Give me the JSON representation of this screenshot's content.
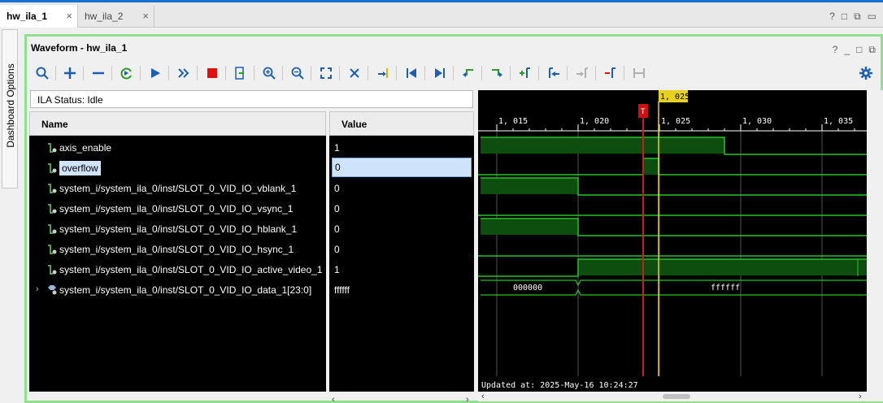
{
  "tabs": [
    {
      "label": "hw_ila_1",
      "close": "×"
    },
    {
      "label": "hw_ila_2",
      "close": "×"
    }
  ],
  "top_icons": [
    "?",
    "□",
    "⧉",
    "▭"
  ],
  "sidebar": {
    "label": "Dashboard Options"
  },
  "panel": {
    "title": "Waveform - hw_ila_1",
    "icons": [
      "?",
      "_",
      "□",
      "⧉"
    ]
  },
  "ila_status": "ILA Status:  Idle",
  "columns": {
    "name": "Name",
    "value": "Value"
  },
  "signals": [
    {
      "name": "axis_enable",
      "value": "1"
    },
    {
      "name": "overflow",
      "value": "0"
    },
    {
      "name": "system_i/system_ila_0/inst/SLOT_0_VID_IO_vblank_1",
      "value": "0"
    },
    {
      "name": "system_i/system_ila_0/inst/SLOT_0_VID_IO_vsync_1",
      "value": "0"
    },
    {
      "name": "system_i/system_ila_0/inst/SLOT_0_VID_IO_hblank_1",
      "value": "0"
    },
    {
      "name": "system_i/system_ila_0/inst/SLOT_0_VID_IO_hsync_1",
      "value": "0"
    },
    {
      "name": "system_i/system_ila_0/inst/SLOT_0_VID_IO_active_video_1",
      "value": "1"
    },
    {
      "name": "system_i/system_ila_0/inst/SLOT_0_VID_IO_data_1[23:0]",
      "value": "ffffff"
    }
  ],
  "timeline": {
    "ticks": [
      "1, 015",
      "1, 020",
      "1, 025",
      "1, 030",
      "1, 035"
    ],
    "cursor_label": "1, 025",
    "trigger_marker": "T",
    "bus_values": [
      "000000",
      "ffffff"
    ],
    "updated": "Updated at: 2025-May-16 10:24:27"
  },
  "colors": {
    "accent": "#1a6fd0",
    "panel_border": "#90e090",
    "wave": "#29c229",
    "cursor": "#e8d020",
    "trigger": "#c81e1e"
  }
}
